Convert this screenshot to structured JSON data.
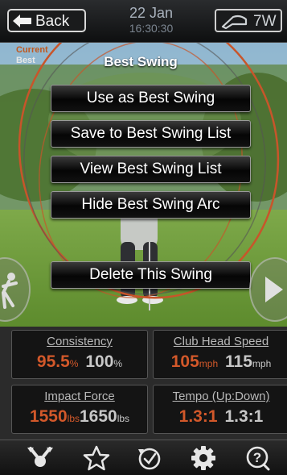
{
  "header": {
    "back_label": "Back",
    "date": "22 Jan",
    "time": "16:30:30",
    "club_label": "7W"
  },
  "legend": {
    "current": "Current",
    "best": "Best"
  },
  "menu": {
    "title": "Best Swing",
    "items": [
      {
        "label": "Use as Best Swing"
      },
      {
        "label": "Save to Best Swing List"
      },
      {
        "label": "View Best Swing List"
      },
      {
        "label": "Hide Best Swing Arc"
      },
      {
        "label": "Delete This Swing"
      }
    ]
  },
  "stats": [
    {
      "title": "Consistency",
      "current": "95.5",
      "current_unit": "%",
      "best": "100",
      "best_unit": "%"
    },
    {
      "title": "Club Head Speed",
      "current": "105",
      "current_unit": "mph",
      "best": "115",
      "best_unit": "mph"
    },
    {
      "title": "Impact Force",
      "current": "1550",
      "current_unit": "lbs",
      "best": "1650",
      "best_unit": "lbs"
    },
    {
      "title": "Tempo (Up:Down)",
      "current": "1.3:1",
      "current_unit": "",
      "best": "1.3:1",
      "best_unit": ""
    }
  ],
  "tabs": [
    {
      "icon": "swing-analysis-icon"
    },
    {
      "icon": "star-icon"
    },
    {
      "icon": "history-icon"
    },
    {
      "icon": "gear-icon"
    },
    {
      "icon": "help-icon"
    }
  ],
  "colors": {
    "current": "#d2582a",
    "best": "#c7c7c7",
    "button_bg": "#050505"
  }
}
